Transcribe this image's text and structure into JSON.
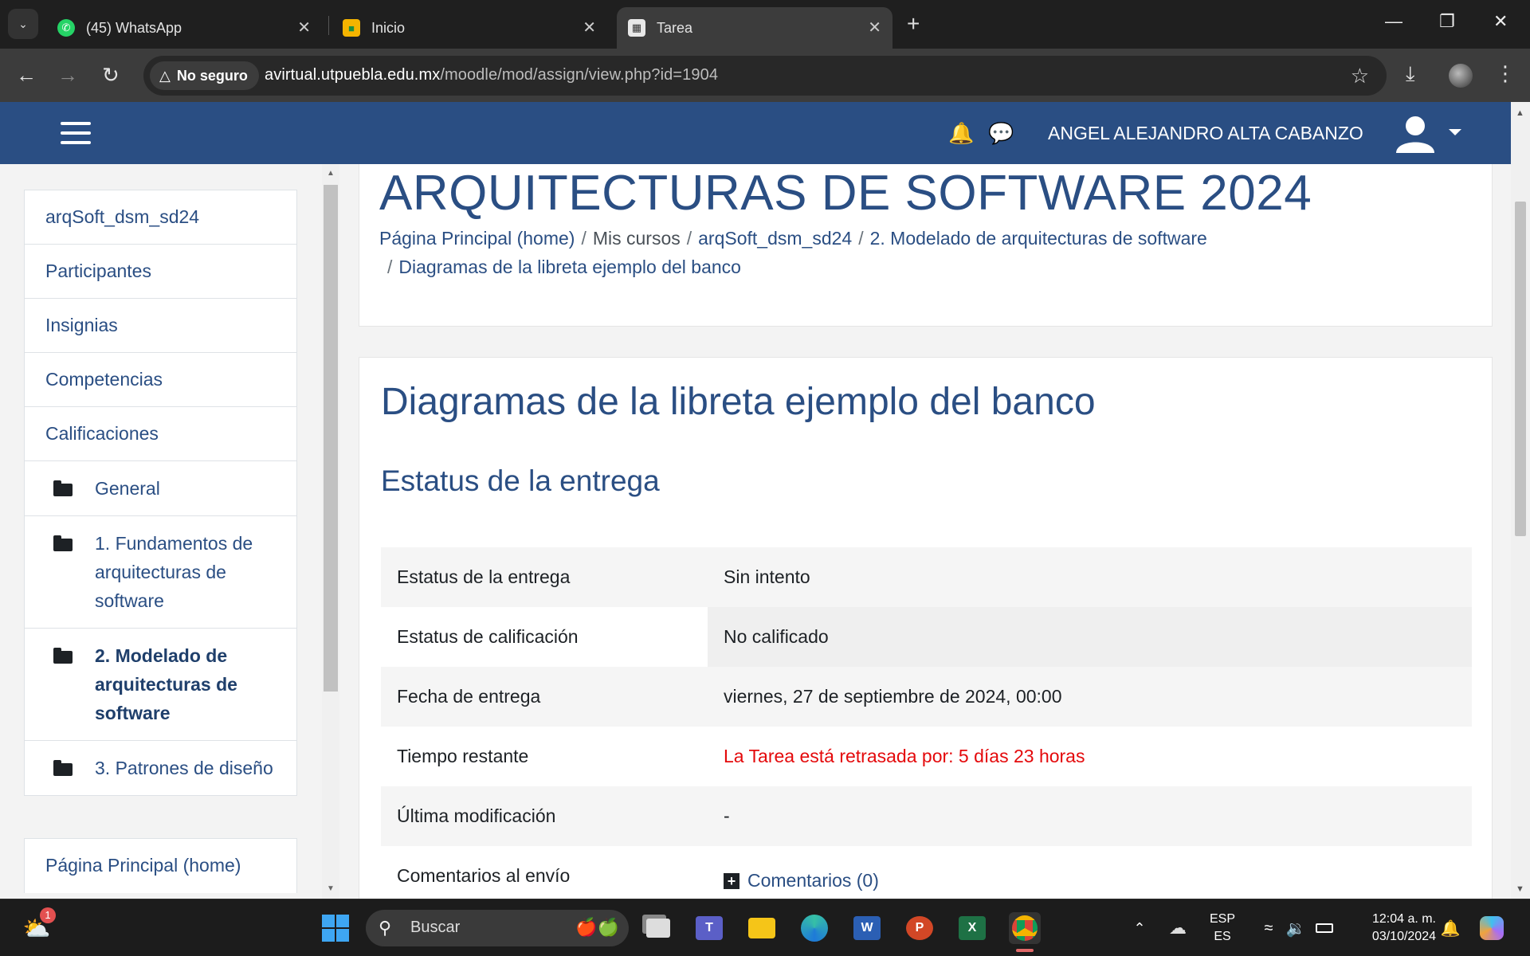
{
  "browser": {
    "tabs": [
      {
        "title": "(45) WhatsApp",
        "icon": "whatsapp-icon"
      },
      {
        "title": "Inicio",
        "icon": "classroom-icon"
      },
      {
        "title": "Tarea",
        "icon": "moodle-icon"
      }
    ],
    "security_label": "No seguro",
    "url_host": "avirtual.utpuebla.edu.mx",
    "url_path": "/moodle/mod/assign/view.php?id=1904"
  },
  "navbar": {
    "username": "ANGEL ALEJANDRO ALTA CABANZO"
  },
  "drawer": {
    "items": [
      {
        "label": "arqSoft_dsm_sd24"
      },
      {
        "label": "Participantes"
      },
      {
        "label": "Insignias"
      },
      {
        "label": "Competencias"
      },
      {
        "label": "Calificaciones"
      }
    ],
    "sections": [
      {
        "label": "General"
      },
      {
        "label": "1. Fundamentos de arquitecturas de software"
      },
      {
        "label": "2. Modelado de arquitecturas de software",
        "current": true
      },
      {
        "label": "3. Patrones de diseño"
      }
    ],
    "footer_item": "Página Principal (home)"
  },
  "header": {
    "course_title": "ARQUITECTURAS DE SOFTWARE 2024",
    "breadcrumb": [
      "Página Principal (home)",
      "Mis cursos",
      "arqSoft_dsm_sd24",
      "2. Modelado de arquitecturas de software",
      "Diagramas de la libreta ejemplo del banco"
    ]
  },
  "assignment": {
    "title": "Diagramas de la libreta ejemplo del banco",
    "status_heading": "Estatus de la entrega",
    "rows": [
      {
        "key": "Estatus de la entrega",
        "value": "Sin intento"
      },
      {
        "key": "Estatus de calificación",
        "value": "No calificado"
      },
      {
        "key": "Fecha de entrega",
        "value": "viernes, 27 de septiembre de 2024, 00:00"
      },
      {
        "key": "Tiempo restante",
        "value": "La Tarea está retrasada por: 5 días 23 horas"
      },
      {
        "key": "Última modificación",
        "value": "-"
      },
      {
        "key": "Comentarios al envío",
        "value": "Comentarios (0)"
      }
    ],
    "late_color": "#e4090b"
  },
  "taskbar": {
    "search_placeholder": "Buscar",
    "weather_badge": "1",
    "lang_line1": "ESP",
    "lang_line2": "ES",
    "time": "12:04 a. m.",
    "date": "03/10/2024"
  },
  "colors": {
    "moodle_primary": "#2a4e83",
    "chrome_dark": "#1f1f1f"
  }
}
